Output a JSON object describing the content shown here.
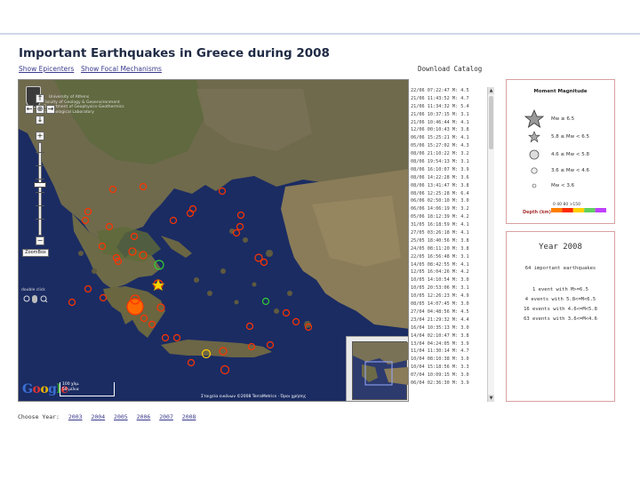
{
  "title": "Important Earthquakes in Greece during 2008",
  "nav": {
    "show_epicenters": "Show Epicenters",
    "show_focal": "Show Focal Mechanisms",
    "download": "Download Catalog"
  },
  "map": {
    "credit": "University of Athens\nFaculty of Geology & Geoenvironment\nDepartment of Geophysics-Geothermics\nSeismological Laboratory",
    "zoombox": "ZoomBox",
    "double_click": "double click",
    "google": "Google",
    "scale_km": "100 χλμ.",
    "scale_mi": "50 μίλια",
    "copyright": "Στοιχεία εικόνων ©2008 TerraMetrics · Όροι χρήσης",
    "nav_up": "↑",
    "nav_left": "←",
    "nav_right": "→",
    "nav_down": "↓",
    "nav_center": "⊕",
    "zoom_in": "+",
    "zoom_out": "−"
  },
  "quakes": [
    "22/06 07:22:47  M: 4.5",
    "21/06 11:43:52  M: 4.7",
    "21/06 11:34:32  M: 5.4",
    "21/06 10:37:15  M: 3.1",
    "21/06 10:46:44  M: 4.1",
    "12/06 00:10:43  M: 3.8",
    "06/06 15:25:21  M: 4.1",
    "05/06 15:27:02  M: 4.3",
    "08/06 21:10:22  M: 3.2",
    "08/06 19:54:13  M: 3.1",
    "08/06 16:10:07  M: 3.9",
    "08/06 14:22:28  M: 3.6",
    "08/06 13:41:47  M: 3.8",
    "08/06 12:25:28  M: 6.4",
    "06/06 02:50:10  M: 3.0",
    "06/06 14:06:19  M: 3.2",
    "05/06 18:12:39  M: 4.2",
    "31/05 16:18:59  M: 4.1",
    "27/05 03:26:18  M: 4.1",
    "25/05 18:40:56  M: 3.8",
    "24/05 08:11:20  M: 3.8",
    "22/05 16:56:48  M: 3.1",
    "14/05 08:42:55  M: 4.1",
    "12/05 16:04:26  M: 4.2",
    "10/05 14:10:54  M: 3.0",
    "10/05 20:53:06  M: 3.1",
    "10/05 12:26:23  M: 4.9",
    "08/05 14:07:45  M: 3.0",
    "27/04 04:48:56  M: 4.5",
    "23/04 21:29:32  M: 4.4",
    "16/04 10:35:13  M: 3.0",
    "14/04 02:10:47  M: 3.8",
    "13/04 04:24:05  M: 3.9",
    "11/04 11:30:14  M: 4.7",
    "10/04 08:10:38  M: 3.0",
    "10/04 15:18:56  M: 3.3",
    "07/04 10:09:15  M: 3.0",
    "06/04 02:36:30  M: 3.9"
  ],
  "legend": {
    "title": "Moment Magnitude",
    "rows": [
      {
        "label": "Mw ≥ 6.5"
      },
      {
        "label": "5.8 ≤ Mw < 6.5"
      },
      {
        "label": "4.6 ≤ Mw < 5.8"
      },
      {
        "label": "3.6 ≤ Mw < 4.6"
      },
      {
        "label": "Mw < 3.6"
      }
    ],
    "depth_label": "Depth (km)",
    "depth_ticks": "0   40   80   >150",
    "depth_colors": [
      "#ff7f00",
      "#ff2a00",
      "#ffd000",
      "#60d060",
      "#c040ff"
    ]
  },
  "year_box": {
    "title": "Year 2008",
    "count": "64 important earthquakes",
    "lines": [
      "1 event with M>=6.5",
      "4 events with 5.8<=M<6.5",
      "16 events with 4.6<=M<5.8",
      "63 events with 3.6<=M<4.6"
    ]
  },
  "choose_year": {
    "label": "Choose Year:",
    "years": [
      "2003",
      "2004",
      "2005",
      "2006",
      "2007",
      "2008"
    ]
  }
}
